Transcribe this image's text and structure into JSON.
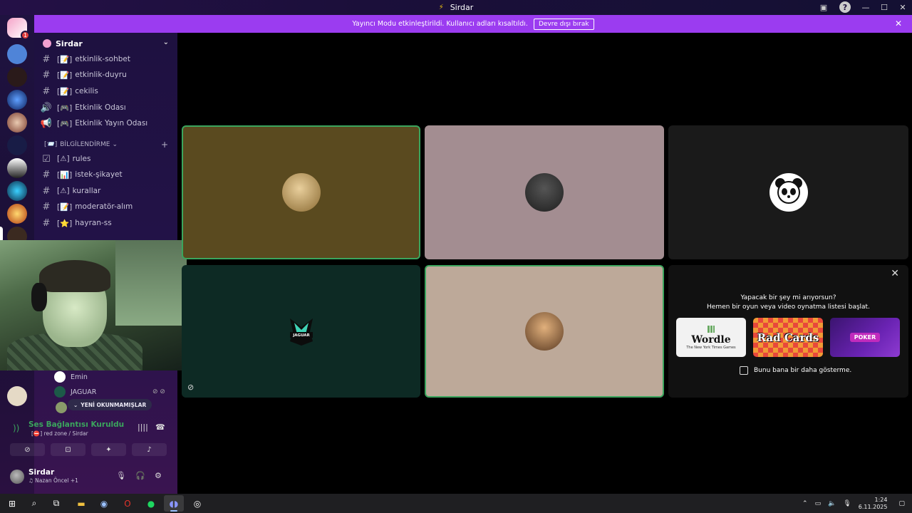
{
  "window": {
    "title": "Sirdar"
  },
  "banner": {
    "text": "Yayıncı Modu etkinleştirildi. Kullanıcı adları kısaltıldı.",
    "button_label": "Devre dışı bırak"
  },
  "guild_badge": "1",
  "server": {
    "name": "Sirdar"
  },
  "channels": [
    {
      "icon": "text-channel-icon",
      "label": "etkinlik-sohbet",
      "prefix": "[📝]"
    },
    {
      "icon": "text-channel-icon",
      "label": "etkinlik-duyru",
      "prefix": "[📝]"
    },
    {
      "icon": "text-channel-icon",
      "label": "cekilis",
      "prefix": "[📝]"
    },
    {
      "icon": "voice-channel-icon",
      "label": "Etkinlik Odası",
      "prefix": "[🎮]"
    },
    {
      "icon": "stage-channel-icon",
      "label": "Etkinlik Yayın Odası",
      "prefix": "[🎮]"
    }
  ],
  "category": {
    "label": "BİLGİLENDİRME",
    "prefix": "[📨]"
  },
  "info_channels": [
    {
      "icon": "rules-channel-icon",
      "label": "rules",
      "prefix": "[⚠]"
    },
    {
      "icon": "text-channel-icon",
      "label": "istek-şikayet",
      "prefix": "[📊]"
    },
    {
      "icon": "text-channel-icon",
      "label": "kurallar",
      "prefix": "[⚠]"
    },
    {
      "icon": "text-channel-icon",
      "label": "moderatör-alım",
      "prefix": "[📝]"
    },
    {
      "icon": "text-channel-icon",
      "label": "hayran-ss",
      "prefix": "[⭐]"
    }
  ],
  "voice_members": [
    {
      "name": "Emin"
    },
    {
      "name": "JAGUAR"
    }
  ],
  "new_unreads_label": "YENİ OKUNMAMIŞLAR",
  "voice_panel": {
    "status": "Ses Bağlantısı Kuruldu",
    "location": "red zone / Sirdar",
    "location_prefix": "[⛔]"
  },
  "user": {
    "name": "Sirdar",
    "activity": "Nazan Öncel +1"
  },
  "tiles": [
    {
      "name": "tile-user-1",
      "color": "#5a4a1f",
      "speaking": true
    },
    {
      "name": "tile-user-2",
      "color": "#a38d91",
      "speaking": false
    },
    {
      "name": "tile-user-3",
      "color": "#1a1a1a",
      "speaking": false
    },
    {
      "name": "tile-jaguar",
      "color": "#0d2a24",
      "speaking": false
    },
    {
      "name": "tile-user-5",
      "color": "#bda999",
      "speaking": true
    }
  ],
  "jaguar_logo_text": "JAGUAR",
  "activity_panel": {
    "question": "Yapacak bir şey mi arıyorsun?",
    "suggestion": "Hemen bir oyun veya video oynatma listesi başlat.",
    "cards": [
      {
        "name": "Wordle",
        "subtitle": "The New York Times Games"
      },
      {
        "name": "Rad Cards",
        "subtitle": "PLAY AT YOUR OWN RISK"
      },
      {
        "name": "POKER",
        "subtitle": ""
      }
    ],
    "dont_show_label": "Bunu bana bir daha gösterme."
  },
  "taskbar": {
    "time": "1:24",
    "date": "6.11.2025"
  },
  "colors": {
    "accent": "#9b3cf0",
    "speaking": "#3ba55d",
    "sidebar_top": "#1e1140",
    "sidebar_bottom": "#3a1450"
  }
}
